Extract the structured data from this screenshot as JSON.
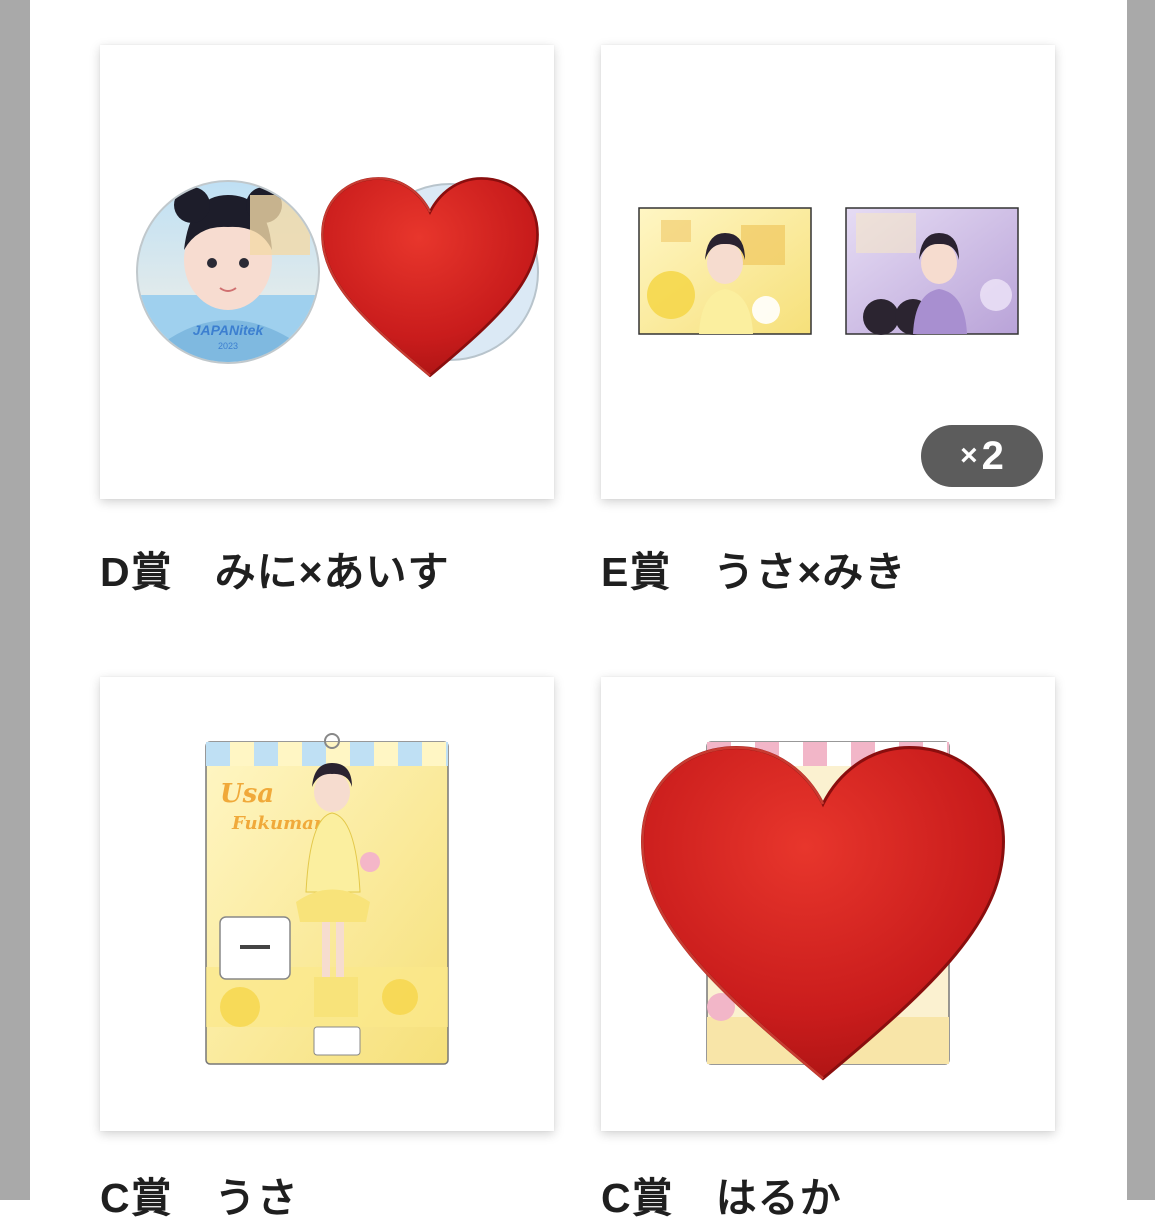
{
  "prizes": [
    {
      "label": "D賞　みに×あいす",
      "image_name": "can-badge-pair"
    },
    {
      "label": "E賞　うさ×みき",
      "image_name": "bromide-pair",
      "badge": {
        "prefix": "×",
        "count": "2"
      }
    },
    {
      "label": "C賞　うさ",
      "image_name": "acrylic-stand",
      "stand_text_1": "Usa",
      "stand_text_2": "Fukumaru"
    },
    {
      "label": "C賞　はるか",
      "image_name": "acrylic-stand"
    }
  ],
  "badge_logo_text": "JAPANitek",
  "badge_year": "2023",
  "overlay_icon": "red-heart-emoji",
  "colors": {
    "side_gray": "#a9a9a9",
    "heart_red": "#c91c1c",
    "badge_bg": "#5c5c5c",
    "lemon_yellow": "#fbe88a",
    "lavender": "#c7b4e0",
    "pink": "#f2b6c8"
  }
}
